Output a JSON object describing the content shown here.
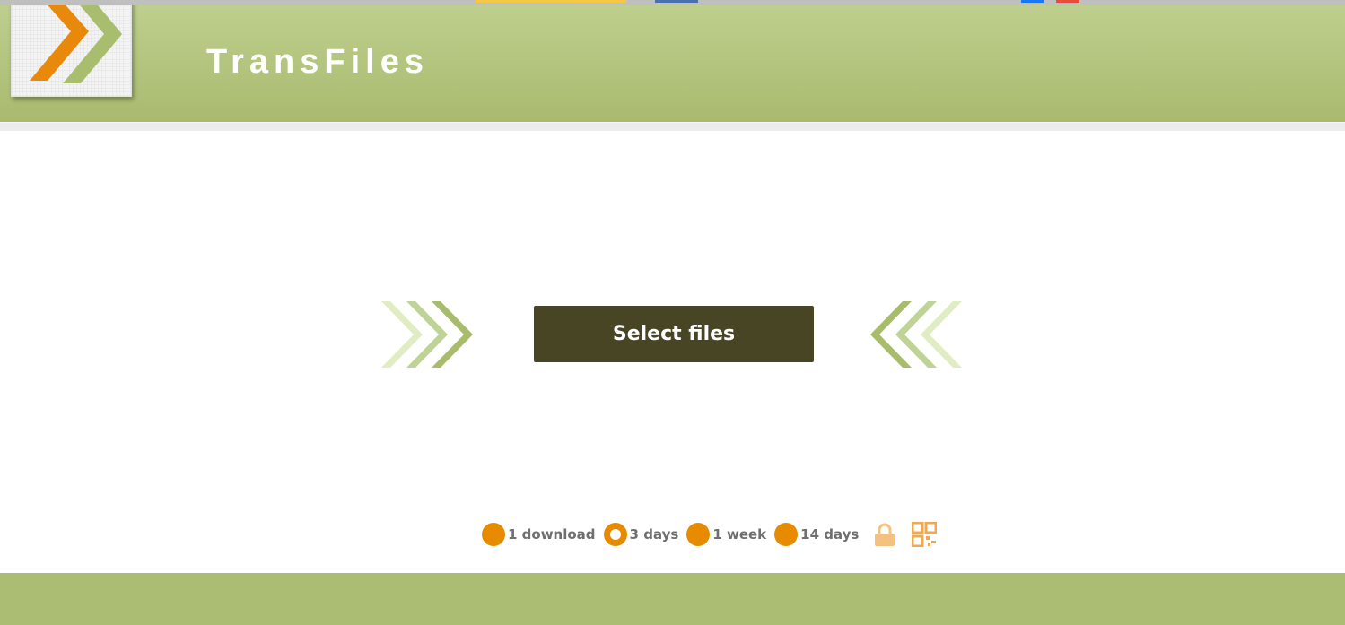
{
  "app": {
    "title": "TransFiles"
  },
  "colors": {
    "header": "#adbe73",
    "accent": "#e68a00",
    "button": "#474523",
    "footer": "#aabd72",
    "muted_text": "#6f6f6f"
  },
  "main": {
    "select_button_label": "Select files"
  },
  "expiry_options": [
    {
      "label": "1 download",
      "selected": false
    },
    {
      "label": "3 days",
      "selected": true
    },
    {
      "label": "1 week",
      "selected": false
    },
    {
      "label": "14 days",
      "selected": false
    }
  ],
  "tools": [
    {
      "icon": "lock-icon"
    },
    {
      "icon": "qr-code-icon"
    }
  ]
}
